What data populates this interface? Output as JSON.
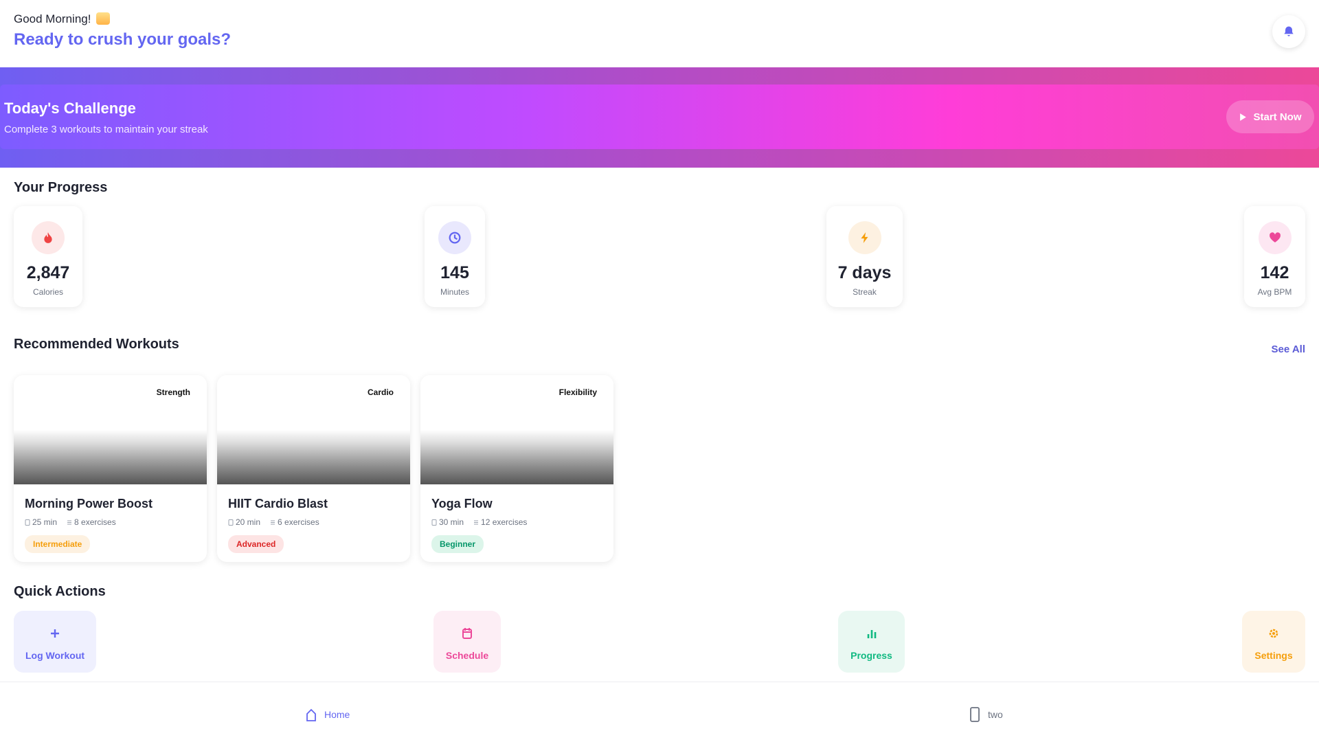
{
  "header": {
    "greeting": "Good Morning!",
    "greeting_emoji_icon": "sunrise-icon",
    "tagline": "Ready to crush your goals?",
    "notification_icon": "bell-icon"
  },
  "challenge": {
    "title": "Today's Challenge",
    "subtitle": "Complete 3 workouts to maintain your streak",
    "button_label": "Start Now",
    "button_icon": "play-icon"
  },
  "progress": {
    "title": "Your Progress",
    "stats": [
      {
        "value": "2,847",
        "label": "Calories",
        "icon": "flame-icon",
        "color": "#ef4444",
        "bg": "#fde8e8"
      },
      {
        "value": "145",
        "label": "Minutes",
        "icon": "clock-icon",
        "color": "#6366f1",
        "bg": "#e9e8fd"
      },
      {
        "value": "7 days",
        "label": "Streak",
        "icon": "bolt-icon",
        "color": "#f59e0b",
        "bg": "#fdf1e1"
      },
      {
        "value": "142",
        "label": "Avg BPM",
        "icon": "heart-icon",
        "color": "#ec4899",
        "bg": "#fde7f2"
      }
    ]
  },
  "workouts": {
    "title": "Recommended Workouts",
    "see_all": "See All",
    "items": [
      {
        "category": "Strength",
        "name": "Morning Power Boost",
        "duration": "25 min",
        "exercises": "8 exercises",
        "level": "Intermediate",
        "level_color": "#f59e0b",
        "level_bg": "#fdf1e1"
      },
      {
        "category": "Cardio",
        "name": "HIIT Cardio Blast",
        "duration": "20 min",
        "exercises": "6 exercises",
        "level": "Advanced",
        "level_color": "#dc2626",
        "level_bg": "#fde4e4"
      },
      {
        "category": "Flexibility",
        "name": "Yoga Flow",
        "duration": "30 min",
        "exercises": "12 exercises",
        "level": "Beginner",
        "level_color": "#059669",
        "level_bg": "#dcf5ea"
      }
    ]
  },
  "quick_actions": {
    "title": "Quick Actions",
    "items": [
      {
        "label": "Log Workout",
        "icon": "plus-icon",
        "color": "#6366f1",
        "bg": "#eff0fe"
      },
      {
        "label": "Schedule",
        "icon": "calendar-icon",
        "color": "#ec4899",
        "bg": "#fdeef5"
      },
      {
        "label": "Progress",
        "icon": "chart-icon",
        "color": "#10b981",
        "bg": "#e9f8f2"
      },
      {
        "label": "Settings",
        "icon": "gear-icon",
        "color": "#f59e0b",
        "bg": "#fef4e6"
      }
    ]
  },
  "nav": {
    "items": [
      {
        "label": "Home",
        "icon": "home-icon",
        "active": true,
        "color": "#6366f1"
      },
      {
        "label": "two",
        "icon": "phone-icon",
        "active": false,
        "color": "#6b7280"
      }
    ]
  }
}
